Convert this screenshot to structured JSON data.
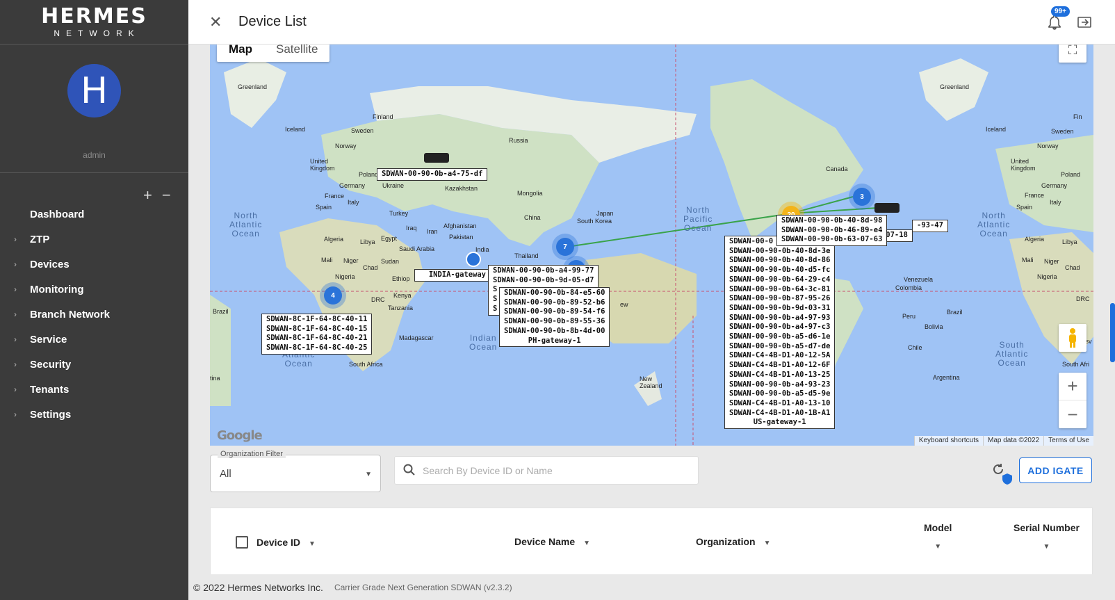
{
  "brand": {
    "top": "HERMES",
    "bottom": "NETWORK"
  },
  "user": {
    "initial": "H",
    "name": "admin"
  },
  "tree_controls": {
    "expand": "+",
    "collapse": "−"
  },
  "nav": [
    {
      "label": "Dashboard",
      "expandable": false
    },
    {
      "label": "ZTP",
      "expandable": true
    },
    {
      "label": "Devices",
      "expandable": true
    },
    {
      "label": "Monitoring",
      "expandable": true
    },
    {
      "label": "Branch Network",
      "expandable": true
    },
    {
      "label": "Service",
      "expandable": true
    },
    {
      "label": "Security",
      "expandable": true
    },
    {
      "label": "Tenants",
      "expandable": true
    },
    {
      "label": "Settings",
      "expandable": true
    }
  ],
  "header": {
    "title": "Device List",
    "notifications": "99+"
  },
  "map": {
    "tabs": [
      "Map",
      "Satellite"
    ],
    "active_tab": "Map",
    "logo": "Google",
    "footer": [
      "Keyboard shortcuts",
      "Map data ©2022",
      "Terms of Use"
    ],
    "oceans": {
      "north_atlantic_left": "North\nAtlantic\nOcean",
      "north_pacific": "North\nPacific\nOcean",
      "north_atlantic_right": "North\nAtlantic\nOcean",
      "indian": "Indian\nOcean",
      "atlantic_south": "Atlantic\nOcean",
      "south_atlantic": "South\nAtlantic\nOcean"
    },
    "places": {
      "greenland_l": "Greenland",
      "finland": "Finland",
      "iceland_l": "Iceland",
      "sweden_l": "Sweden",
      "norway_l": "Norway",
      "russia": "Russia",
      "uk_l": "United\nKingdom",
      "poland_l": "Poland",
      "germany_l": "Germany",
      "ukraine": "Ukraine",
      "kazakhstan": "Kazakhstan",
      "mongolia": "Mongolia",
      "france_l": "France",
      "italy_l": "Italy",
      "spain_l": "Spain",
      "turkey": "Turkey",
      "china": "China",
      "japan": "Japan",
      "south_korea": "South Korea",
      "iraq": "Iraq",
      "iran": "Iran",
      "afghanistan": "Afghanistan",
      "pakistan": "Pakistan",
      "algeria_l": "Algeria",
      "libya_l": "Libya",
      "egypt": "Egypt",
      "saudi": "Saudi Arabia",
      "india": "India",
      "thailand": "Thailand",
      "mali_l": "Mali",
      "niger_l": "Niger",
      "chad_l": "Chad",
      "sudan": "Sudan",
      "nigeria_l": "Nigeria",
      "ethiopia": "Ethiop",
      "drc_l": "DRC",
      "kenya": "Kenya",
      "tanzania": "Tanzania",
      "brazil_l": "Brazil",
      "madagascar": "Madagascar",
      "south_africa": "South Africa",
      "new_zealand": "New\nZealand",
      "tina": "tina",
      "canada": "Canada",
      "greenland_r": "Greenland",
      "iceland_r": "Iceland",
      "sweden_r": "Sweden",
      "norway_r": "Norway",
      "uk_r": "United\nKingdom",
      "poland_r": "Poland",
      "germany_r": "Germany",
      "france_r": "France",
      "spain_r": "Spain",
      "italy_r": "Italy",
      "algeria_r": "Algeria",
      "libya_r": "Libya",
      "mali_r": "Mali",
      "niger_r": "Niger",
      "chad_r": "Chad",
      "nigeria_r": "Nigeria",
      "drc_r": "DRC",
      "venezuela": "Venezuela",
      "colombia": "Colombia",
      "peru": "Peru",
      "bolivia": "Bolivia",
      "brazil_r": "Brazil",
      "chile": "Chile",
      "argentina": "Argentina",
      "ew": "ew",
      "south_afri_r": "South Afri",
      "botsv": "Botsv",
      "fin_r": "Fin"
    },
    "clusters": {
      "c4": "4",
      "c7": "7",
      "c6": "6",
      "c3": "3",
      "c_orange": "20"
    },
    "device_labels": {
      "russia": [
        "SDWAN-00-90-0b-a4-75-df"
      ],
      "india": [
        "INDIA-gateway"
      ],
      "africa": [
        "SDWAN-8C-1F-64-8C-40-11",
        "SDWAN-8C-1F-64-8C-40-15",
        "SDWAN-8C-1F-64-8C-40-21",
        "SDWAN-8C-1F-64-8C-40-25"
      ],
      "asia_back": [
        "SDWAN-00-90-0b-a4-99-77",
        "SDWAN-00-90-0b-9d-05-d7",
        "S",
        "S",
        "S"
      ],
      "asia_front": [
        "SDWAN-00-90-0b-84-e5-60",
        "SDWAN-00-90-0b-89-52-b6",
        "SDWAN-00-90-0b-89-54-f6",
        "SDWAN-00-90-0b-89-55-36",
        "SDWAN-00-90-0b-8b-4d-00"
      ],
      "asia_front_gateway": "PH-gateway-1",
      "us": [
        "SDWAN-00-0",
        "SDWAN-00-90-0b-40-8d-3e",
        "SDWAN-00-90-0b-40-8d-86",
        "SDWAN-00-90-0b-40-d5-fc",
        "SDWAN-00-90-0b-64-29-c4",
        "SDWAN-00-90-0b-64-3c-81",
        "SDWAN-00-90-0b-87-95-26",
        "SDWAN-00-90-0b-9d-03-31",
        "SDWAN-00-90-0b-a4-97-93",
        "SDWAN-00-90-0b-a4-97-c3",
        "SDWAN-00-90-0b-a5-d6-1e",
        "SDWAN-00-90-0b-a5-d7-de",
        "SDWAN-C4-4B-D1-A0-12-5A",
        "SDWAN-C4-4B-D1-A0-12-6F",
        "SDWAN-C4-4B-D1-A0-13-25",
        "SDWAN-00-90-0b-a4-93-23",
        "SDWAN-00-90-0b-a5-d5-9e",
        "SDWAN-C4-4B-D1-A0-13-10",
        "SDWAN-C4-4B-D1-A0-1B-A1"
      ],
      "us_gateway": "US-gateway-1",
      "east": [
        "SDWAN-00-90-0b-40-8d-98",
        "SDWAN-00-90-0b-46-89-e4",
        "SDWAN-00-90-0b-63-07-63"
      ],
      "east_partial_1": "-93-47",
      "east_partial_2": "-43-07-18"
    }
  },
  "filters": {
    "org_label": "Organization Filter",
    "org_value": "All",
    "search_placeholder": "Search By Device ID or Name",
    "add_button": "ADD IGATE"
  },
  "table": {
    "columns": [
      "Device ID",
      "Device Name",
      "Organization",
      "Model",
      "Serial Number"
    ]
  },
  "footer": {
    "copyright": "© 2022 Hermes Networks Inc.",
    "version": "Carrier Grade Next Generation SDWAN (v2.3.2)"
  },
  "colors": {
    "accent": "#1e6fdc",
    "sidebar": "#3b3b3b",
    "avatar": "#2f54b8",
    "map_water": "#9fc3f5",
    "cluster_orange": "#f3b41a"
  }
}
